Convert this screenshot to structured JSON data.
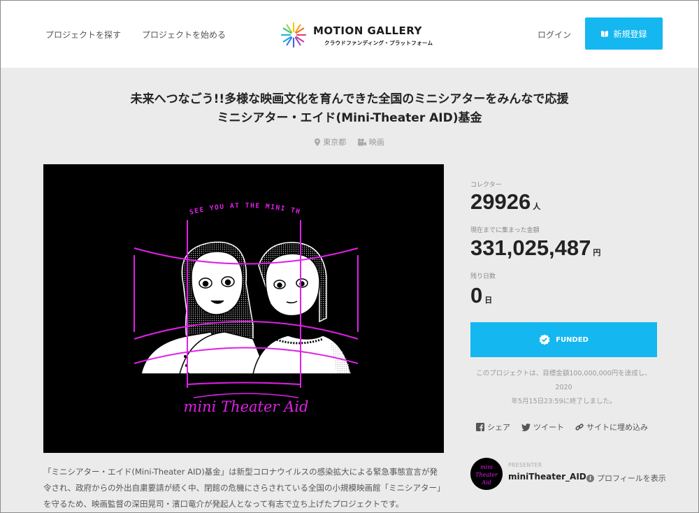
{
  "header": {
    "nav": [
      "プロジェクトを探す",
      "プロジェクトを始める"
    ],
    "logo_title": "MOTION GALLERY",
    "logo_subtitle": "クラウドファンディング・プラットフォーム",
    "login": "ログイン",
    "signup": "新規登録"
  },
  "project": {
    "title_line1": "未来へつなごう!!多様な映画文化を育んできた全国のミニシアターをみんなで応援",
    "title_line2": "ミニシアター・エイド(Mini-Theater AID)基金",
    "location": "東京都",
    "category": "映画",
    "artwork": {
      "top_text": "SEE YOU AT THE MINI THEATER.",
      "bottom_text": "mini Theater Aid",
      "accent_color": "#e020e8"
    },
    "description": "「ミニシアター・エイド(Mini-Theater AID)基金」は新型コロナウイルスの感染拡大による緊急事態宣言が発令され、政府からの外出自粛要請が続く中、閉館の危機にさらされている全国の小規模映画館「ミニシアター」を守るため、映画監督の深田晃司・濱口竜介が発起人となって有志で立ち上げたプロジェクトです。"
  },
  "stats": {
    "collectors_label": "コレクター",
    "collectors_value": "29926",
    "collectors_unit": "人",
    "amount_label": "現在までに集まった金額",
    "amount_value": "331,025,487",
    "amount_unit": "円",
    "days_label": "残り日数",
    "days_value": "0",
    "days_unit": "日"
  },
  "funded": {
    "label": "FUNDED",
    "note_line1": "このプロジェクトは、目標金額100,000,000円を達成し、2020",
    "note_line2": "年5月15日23:59に終了しました。"
  },
  "share": {
    "facebook": "シェア",
    "twitter": "ツイート",
    "embed": "サイトに埋め込み"
  },
  "presenter": {
    "label": "PRESENTER",
    "name": "miniTheater_AID",
    "profile_link": "プロフィールを表示",
    "avatar_text": "mini Theater Aid"
  },
  "colors": {
    "accent": "#14b7f0",
    "background": "#ebebeb"
  }
}
